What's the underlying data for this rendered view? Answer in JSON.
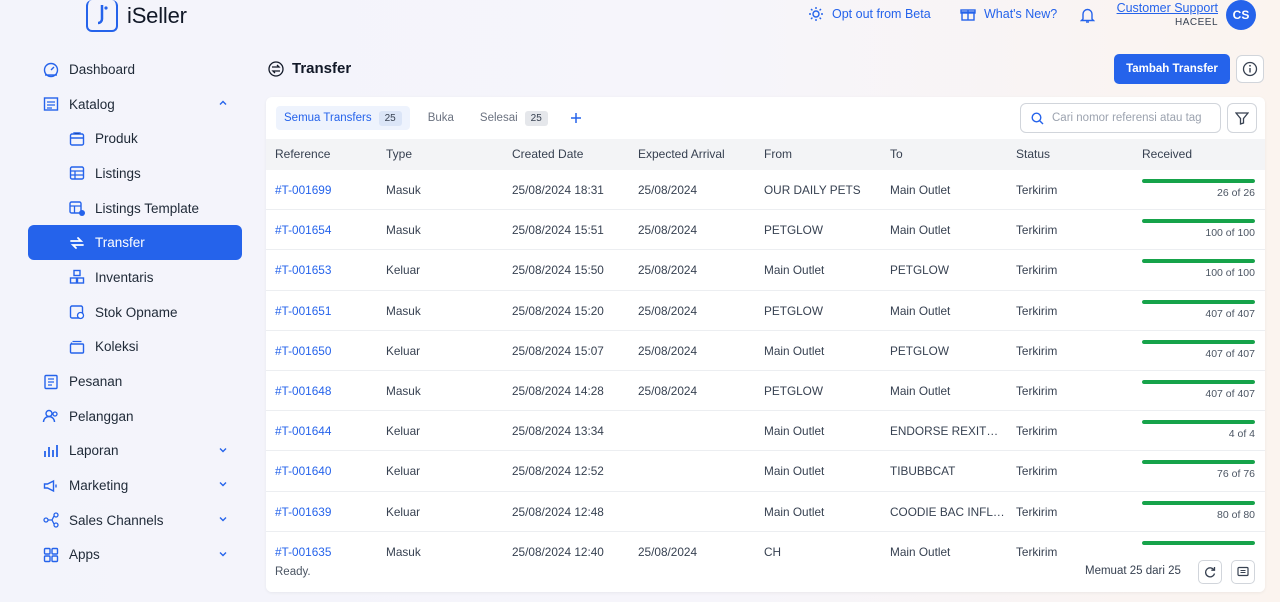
{
  "app": {
    "name": "iSeller"
  },
  "topbar": {
    "opt_out": "Opt out from Beta",
    "whats_new": "What's New?",
    "user_name": "Customer Support",
    "user_org": "HACEEL",
    "avatar_initials": "CS"
  },
  "sidebar": {
    "items": [
      {
        "label": "Dashboard",
        "icon": "dashboard-icon",
        "level": 0
      },
      {
        "label": "Katalog",
        "icon": "catalog-icon",
        "level": 0,
        "chevron": "up"
      },
      {
        "label": "Produk",
        "icon": "product-icon",
        "level": 1
      },
      {
        "label": "Listings",
        "icon": "listings-icon",
        "level": 1
      },
      {
        "label": "Listings Template",
        "icon": "listings-template-icon",
        "level": 1
      },
      {
        "label": "Transfer",
        "icon": "transfer-icon",
        "level": 1,
        "active": true
      },
      {
        "label": "Inventaris",
        "icon": "inventory-icon",
        "level": 1
      },
      {
        "label": "Stok Opname",
        "icon": "stock-opname-icon",
        "level": 1
      },
      {
        "label": "Koleksi",
        "icon": "collection-icon",
        "level": 1
      },
      {
        "label": "Pesanan",
        "icon": "orders-icon",
        "level": 0
      },
      {
        "label": "Pelanggan",
        "icon": "customers-icon",
        "level": 0
      },
      {
        "label": "Laporan",
        "icon": "reports-icon",
        "level": 0,
        "chevron": "down"
      },
      {
        "label": "Marketing",
        "icon": "marketing-icon",
        "level": 0,
        "chevron": "down"
      },
      {
        "label": "Sales Channels",
        "icon": "sales-channels-icon",
        "level": 0,
        "chevron": "down"
      },
      {
        "label": "Apps",
        "icon": "apps-icon",
        "level": 0,
        "chevron": "down"
      }
    ]
  },
  "page": {
    "title": "Transfer",
    "add_button": "Tambah Transfer"
  },
  "tabs": [
    {
      "label": "Semua Transfers",
      "count": "25",
      "active": true
    },
    {
      "label": "Buka",
      "count": ""
    },
    {
      "label": "Selesai",
      "count": "25"
    }
  ],
  "search": {
    "placeholder": "Cari nomor referensi atau tag"
  },
  "table": {
    "headers": [
      "Reference",
      "Type",
      "Created Date",
      "Expected Arrival",
      "From",
      "To",
      "Status",
      "Received"
    ],
    "rows": [
      {
        "ref": "#T-001699",
        "type": "Masuk",
        "created": "25/08/2024 18:31",
        "expected": "25/08/2024",
        "from": "OUR DAILY PETS",
        "to": "Main Outlet",
        "status": "Terkirim",
        "received": "26 of 26",
        "progress": 1.0
      },
      {
        "ref": "#T-001654",
        "type": "Masuk",
        "created": "25/08/2024 15:51",
        "expected": "25/08/2024",
        "from": "PETGLOW",
        "to": "Main Outlet",
        "status": "Terkirim",
        "received": "100 of 100",
        "progress": 1.0
      },
      {
        "ref": "#T-001653",
        "type": "Keluar",
        "created": "25/08/2024 15:50",
        "expected": "25/08/2024",
        "from": "Main Outlet",
        "to": "PETGLOW",
        "status": "Terkirim",
        "received": "100 of 100",
        "progress": 1.0
      },
      {
        "ref": "#T-001651",
        "type": "Masuk",
        "created": "25/08/2024 15:20",
        "expected": "25/08/2024",
        "from": "PETGLOW",
        "to": "Main Outlet",
        "status": "Terkirim",
        "received": "407 of 407",
        "progress": 1.0
      },
      {
        "ref": "#T-001650",
        "type": "Keluar",
        "created": "25/08/2024 15:07",
        "expected": "25/08/2024",
        "from": "Main Outlet",
        "to": "PETGLOW",
        "status": "Terkirim",
        "received": "407 of 407",
        "progress": 1.0
      },
      {
        "ref": "#T-001648",
        "type": "Masuk",
        "created": "25/08/2024 14:28",
        "expected": "25/08/2024",
        "from": "PETGLOW",
        "to": "Main Outlet",
        "status": "Terkirim",
        "received": "407 of 407",
        "progress": 1.0
      },
      {
        "ref": "#T-001644",
        "type": "Keluar",
        "created": "25/08/2024 13:34",
        "expected": "",
        "from": "Main Outlet",
        "to": "ENDORSE REXITHE...",
        "status": "Terkirim",
        "received": "4 of 4",
        "progress": 1.0
      },
      {
        "ref": "#T-001640",
        "type": "Keluar",
        "created": "25/08/2024 12:52",
        "expected": "",
        "from": "Main Outlet",
        "to": "TIBUBBCAT",
        "status": "Terkirim",
        "received": "76 of 76",
        "progress": 1.0
      },
      {
        "ref": "#T-001639",
        "type": "Keluar",
        "created": "25/08/2024 12:48",
        "expected": "",
        "from": "Main Outlet",
        "to": "COODIE BAC INFLU...",
        "status": "Terkirim",
        "received": "80 of 80",
        "progress": 1.0
      },
      {
        "ref": "#T-001635",
        "type": "Masuk",
        "created": "25/08/2024 12:40",
        "expected": "25/08/2024",
        "from": "CH",
        "to": "Main Outlet",
        "status": "Terkirim",
        "received": "",
        "progress": 1.0
      }
    ]
  },
  "footer": {
    "status": "Ready.",
    "loaded": "Memuat 25 dari 25"
  },
  "colors": {
    "accent": "#2563eb",
    "progress": "#16a34a"
  }
}
